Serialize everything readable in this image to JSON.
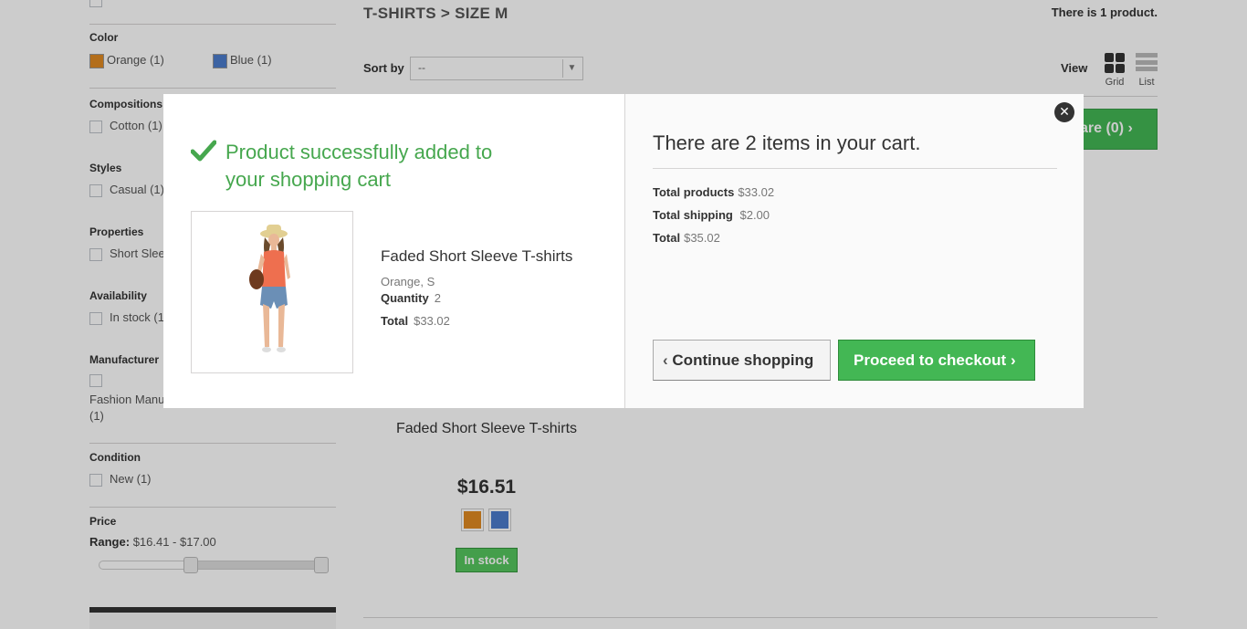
{
  "sidebar": {
    "color": {
      "title": "Color",
      "options": [
        {
          "label": "Orange (1)",
          "swatch": "#e08a22"
        },
        {
          "label": "Blue (1)",
          "swatch": "#4b7ccc"
        }
      ]
    },
    "compositions": {
      "title": "Compositions",
      "option": "Cotton (1)"
    },
    "styles": {
      "title": "Styles",
      "option": "Casual (1)"
    },
    "properties": {
      "title": "Properties",
      "option": "Short Slee"
    },
    "availability": {
      "title": "Availability",
      "option": "In stock (1"
    },
    "manufacturer": {
      "title": "Manufacturer",
      "option": "Fashion Manu",
      "count": "(1)"
    },
    "condition": {
      "title": "Condition",
      "option": "New (1)"
    },
    "price": {
      "title": "Price",
      "range_label": "Range:",
      "range_value": "$16.41 - $17.00"
    }
  },
  "main": {
    "category_title": "T-SHIRTS > SIZE M",
    "product_count": "There is 1 product.",
    "sort_label": "Sort by",
    "sort_value": "--",
    "view_label": "View",
    "view_grid": "Grid",
    "view_list": "List",
    "compare_label": "are (0)",
    "product": {
      "name": "Faded Short Sleeve T-shirts",
      "price": "$16.51",
      "swatches": [
        "#e08a22",
        "#4b7ccc"
      ],
      "stock": "In stock"
    }
  },
  "modal": {
    "success_title": "Product successfully added to your shopping cart",
    "product_name": "Faded Short Sleeve T-shirts",
    "attributes": "Orange, S",
    "quantity_label": "Quantity",
    "quantity_value": "2",
    "total_label": "Total",
    "total_value": "$33.02",
    "cart_heading": "There are 2 items in your cart.",
    "total_products_label": "Total products",
    "total_products_value": "$33.02",
    "total_shipping_label": "Total shipping",
    "total_shipping_value": "$2.00",
    "grand_total_label": "Total",
    "grand_total_value": "$35.02",
    "continue_label": "Continue shopping",
    "checkout_label": "Proceed to checkout",
    "close_glyph": "✕"
  },
  "colors": {
    "accent_green": "#43b754",
    "success_green": "#46a74e"
  }
}
